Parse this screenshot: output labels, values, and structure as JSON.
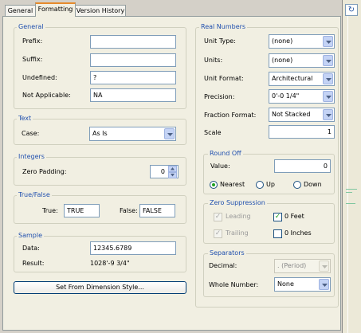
{
  "tabs": [
    "General",
    "Formatting",
    "Version History"
  ],
  "general": {
    "title": "General",
    "prefix_label": "Prefix:",
    "prefix_value": "",
    "suffix_label": "Suffix:",
    "suffix_value": "",
    "undefined_label": "Undefined:",
    "undefined_value": "?",
    "na_label": "Not Applicable:",
    "na_value": "NA"
  },
  "text": {
    "title": "Text",
    "case_label": "Case:",
    "case_value": "As Is"
  },
  "integers": {
    "title": "Integers",
    "zero_padding_label": "Zero Padding:",
    "zero_padding_value": "0"
  },
  "truefalse": {
    "title": "True/False",
    "true_label": "True:",
    "true_value": "TRUE",
    "false_label": "False:",
    "false_value": "FALSE"
  },
  "sample": {
    "title": "Sample",
    "data_label": "Data:",
    "data_value": "12345.6789",
    "result_label": "Result:",
    "result_value": "1028'-9 3/4\""
  },
  "set_from_dim_button": "Set From Dimension Style...",
  "real": {
    "title": "Real Numbers",
    "unit_type_label": "Unit Type:",
    "unit_type_value": "(none)",
    "units_label": "Units:",
    "units_value": "(none)",
    "unit_format_label": "Unit Format:",
    "unit_format_value": "Architectural",
    "precision_label": "Precision:",
    "precision_value": "0'-0 1/4\"",
    "fraction_format_label": "Fraction Format:",
    "fraction_format_value": "Not Stacked",
    "scale_label": "Scale",
    "scale_value": "1"
  },
  "roundoff": {
    "title": "Round Off",
    "value_label": "Value:",
    "value": "0",
    "options": [
      "Nearest",
      "Up",
      "Down"
    ],
    "selected": "Nearest"
  },
  "zero_suppression": {
    "title": "Zero Suppression",
    "leading_label": "Leading",
    "trailing_label": "Trailing",
    "zero_feet_label": "0 Feet",
    "zero_inches_label": "0 Inches",
    "leading_checked": true,
    "trailing_checked": true,
    "zero_feet_checked": true,
    "zero_inches_checked": false
  },
  "separators": {
    "title": "Separators",
    "decimal_label": "Decimal:",
    "decimal_value": ". (Period)",
    "whole_number_label": "Whole Number:",
    "whole_number_value": "None"
  },
  "icons": {
    "refresh": "refresh-icon",
    "dropdown": "chevron-down-icon",
    "check": "check-icon"
  },
  "colors": {
    "group_title": "#1f4fae",
    "active_tab_accent": "#e68b2c",
    "radio_selected": "#21a121"
  }
}
